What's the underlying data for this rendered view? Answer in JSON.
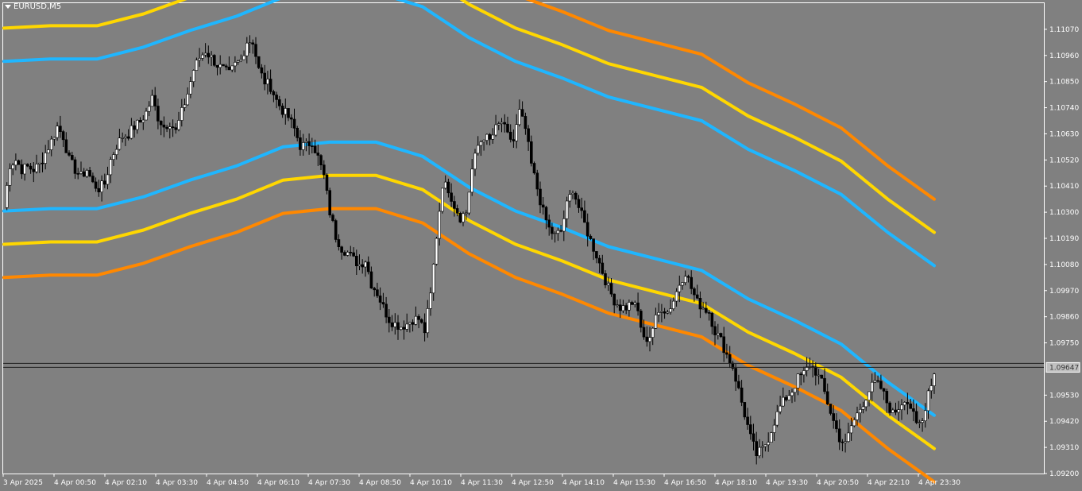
{
  "window": {
    "symbol_title": "EURUSD,M5"
  },
  "current_price": "1.09647",
  "chart_data": {
    "type": "candlestick",
    "title": "EURUSD,M5",
    "ylim": [
      1.092,
      1.1118
    ],
    "y_ticks": [
      "1.11070",
      "1.10960",
      "1.10850",
      "1.10740",
      "1.10630",
      "1.10520",
      "1.10410",
      "1.10300",
      "1.10190",
      "1.10080",
      "1.09970",
      "1.09860",
      "1.09750",
      "1.09530",
      "1.09420",
      "1.09310",
      "1.09200"
    ],
    "x_ticks": [
      "3 Apr 2025",
      "4 Apr 00:50",
      "4 Apr 02:10",
      "4 Apr 03:30",
      "4 Apr 04:50",
      "4 Apr 06:10",
      "4 Apr 07:30",
      "4 Apr 08:50",
      "4 Apr 10:10",
      "4 Apr 11:30",
      "4 Apr 12:50",
      "4 Apr 14:10",
      "4 Apr 15:30",
      "4 Apr 16:50",
      "4 Apr 18:10",
      "4 Apr 19:30",
      "4 Apr 20:50",
      "4 Apr 22:10",
      "4 Apr 23:30"
    ],
    "price_path": [
      1.1032,
      1.105,
      1.1052,
      1.1048,
      1.1049,
      1.1048,
      1.105,
      1.1055,
      1.106,
      1.1066,
      1.1062,
      1.1052,
      1.1048,
      1.1045,
      1.1048,
      1.1042,
      1.104,
      1.1042,
      1.1052,
      1.1058,
      1.1062,
      1.1063,
      1.1066,
      1.1068,
      1.1072,
      1.1078,
      1.107,
      1.1066,
      1.1068,
      1.1064,
      1.1072,
      1.108,
      1.109,
      1.1095,
      1.1098,
      1.1095,
      1.1092,
      1.109,
      1.1088,
      1.1092,
      1.1094,
      1.1102,
      1.1102,
      1.109,
      1.1085,
      1.1083,
      1.1077,
      1.1073,
      1.107,
      1.1065,
      1.1058,
      1.1058,
      1.106,
      1.1053,
      1.1045,
      1.103,
      1.102,
      1.1015,
      1.1013,
      1.101,
      1.1008,
      1.101,
      1.1,
      1.0996,
      1.099,
      1.0985,
      1.0983,
      1.0982,
      1.0983,
      1.0985,
      1.0985,
      1.098,
      1.0995,
      1.102,
      1.1042,
      1.104,
      1.1033,
      1.1028,
      1.103,
      1.1048,
      1.1058,
      1.1062,
      1.106,
      1.1065,
      1.1068,
      1.1062,
      1.106,
      1.1072,
      1.1065,
      1.105,
      1.104,
      1.103,
      1.1023,
      1.102,
      1.1022,
      1.1033,
      1.104,
      1.1032,
      1.1025,
      1.1018,
      1.1012,
      1.1005,
      1.0998,
      1.0993,
      1.099,
      1.099,
      1.0992,
      1.0988,
      1.0976,
      1.0978,
      1.0985,
      1.099,
      1.0988,
      1.0993,
      1.1,
      1.1005,
      1.0998,
      1.0992,
      1.099,
      1.0988,
      1.098,
      1.0976,
      1.097,
      1.0965,
      1.0955,
      1.0945,
      1.0935,
      1.0928,
      1.093,
      1.0935,
      1.0942,
      1.0948,
      1.0952,
      1.0955,
      1.096,
      1.0962,
      1.0966,
      1.0963,
      1.0958,
      1.095,
      1.0942,
      1.0935,
      1.0932,
      1.094,
      1.0945,
      1.095,
      1.0955,
      1.0958,
      1.0956,
      1.095,
      1.0945,
      1.0948,
      1.0952,
      1.0948,
      1.094,
      1.0942,
      1.0955,
      1.0962
    ]
  },
  "bands": {
    "orange": "#ff8800",
    "yellow": "#ffd700",
    "blue": "#1fb6ff",
    "center": [
      1.1062,
      1.1063,
      1.1063,
      1.1068,
      1.1075,
      1.1081,
      1.1089,
      1.1091,
      1.1091,
      1.1085,
      1.1072,
      1.1062,
      1.1055,
      1.1047,
      1.1042,
      1.1037,
      1.1025,
      1.1016,
      1.1006,
      1.099,
      1.0976
    ],
    "offset_inner": 0.00315,
    "offset_middle": 0.00455,
    "offset_outer": 0.00595
  },
  "colors": {
    "background": "#808080",
    "candle_up": "#ffffff",
    "candle_down": "#000000",
    "axis_text": "#ffffff"
  }
}
